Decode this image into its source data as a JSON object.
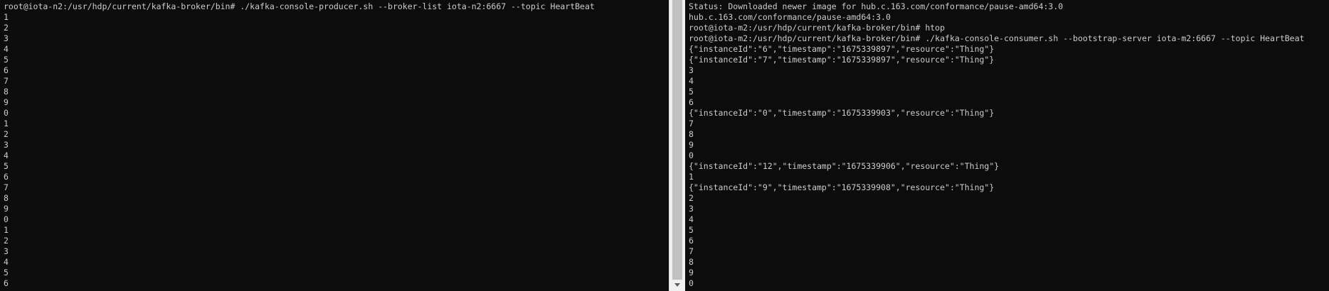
{
  "left_terminal": {
    "lines": [
      "root@iota-n2:/usr/hdp/current/kafka-broker/bin# ./kafka-console-producer.sh --broker-list iota-n2:6667 --topic HeartBeat",
      "1",
      "2",
      "3",
      "4",
      "5",
      "6",
      "7",
      "8",
      "9",
      "0",
      "1",
      "2",
      "3",
      "4",
      "5",
      "6",
      "7",
      "8",
      "9",
      "0",
      "1",
      "2",
      "3",
      "4",
      "5",
      "6"
    ]
  },
  "right_terminal": {
    "lines": [
      "Status: Downloaded newer image for hub.c.163.com/conformance/pause-amd64:3.0",
      "hub.c.163.com/conformance/pause-amd64:3.0",
      "root@iota-m2:/usr/hdp/current/kafka-broker/bin# htop",
      "root@iota-m2:/usr/hdp/current/kafka-broker/bin# ./kafka-console-consumer.sh --bootstrap-server iota-m2:6667 --topic HeartBeat",
      "{\"instanceId\":\"6\",\"timestamp\":\"1675339897\",\"resource\":\"Thing\"}",
      "{\"instanceId\":\"7\",\"timestamp\":\"1675339897\",\"resource\":\"Thing\"}",
      "3",
      "4",
      "5",
      "6",
      "{\"instanceId\":\"0\",\"timestamp\":\"1675339903\",\"resource\":\"Thing\"}",
      "7",
      "8",
      "9",
      "0",
      "{\"instanceId\":\"12\",\"timestamp\":\"1675339906\",\"resource\":\"Thing\"}",
      "1",
      "{\"instanceId\":\"9\",\"timestamp\":\"1675339908\",\"resource\":\"Thing\"}",
      "2",
      "3",
      "4",
      "5",
      "6",
      "7",
      "8",
      "9",
      "0"
    ]
  },
  "colors": {
    "terminal_bg": "#0c0c0c",
    "terminal_fg": "#cccccc",
    "scrollbar_track": "#f0f0f0",
    "scrollbar_thumb": "#c1c1c1"
  }
}
